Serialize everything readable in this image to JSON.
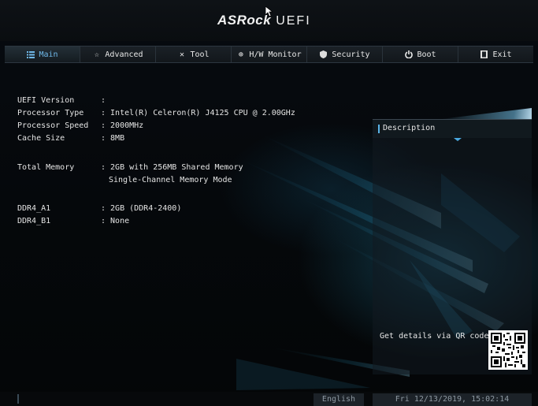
{
  "header": {
    "brand": "ASRock",
    "product": "UEFI"
  },
  "tabs": [
    {
      "label": "Main",
      "icon": "list-icon",
      "active": true
    },
    {
      "label": "Advanced",
      "icon": "star-icon",
      "active": false
    },
    {
      "label": "Tool",
      "icon": "tools-icon",
      "active": false
    },
    {
      "label": "H/W Monitor",
      "icon": "globe-icon",
      "active": false
    },
    {
      "label": "Security",
      "icon": "shield-icon",
      "active": false
    },
    {
      "label": "Boot",
      "icon": "power-icon",
      "active": false
    },
    {
      "label": "Exit",
      "icon": "exit-icon",
      "active": false
    }
  ],
  "main": {
    "uefi_version": {
      "label": "UEFI Version",
      "value": ":"
    },
    "processor_type": {
      "label": "Processor Type",
      "value": ": Intel(R) Celeron(R) J4125 CPU @ 2.00GHz"
    },
    "processor_speed": {
      "label": "Processor Speed",
      "value": ": 2000MHz"
    },
    "cache_size": {
      "label": "Cache Size",
      "value": ": 8MB"
    },
    "total_memory": {
      "label": "Total Memory",
      "value": ": 2GB with 256MB Shared Memory",
      "value2": "Single-Channel Memory Mode"
    },
    "ddr4_a1": {
      "label": "DDR4_A1",
      "value": ": 2GB (DDR4-2400)"
    },
    "ddr4_b1": {
      "label": "DDR4_B1",
      "value": ": None"
    }
  },
  "description": {
    "title": "Description",
    "qr_text": "Get details via QR code"
  },
  "footer": {
    "language": "English",
    "datetime": "Fri 12/13/2019, 15:02:14"
  },
  "colors": {
    "accent": "#5ab4e8",
    "active_tab_text": "#6fb8e8",
    "text": "#e4e4e4",
    "footer_text": "#8e99a2"
  }
}
